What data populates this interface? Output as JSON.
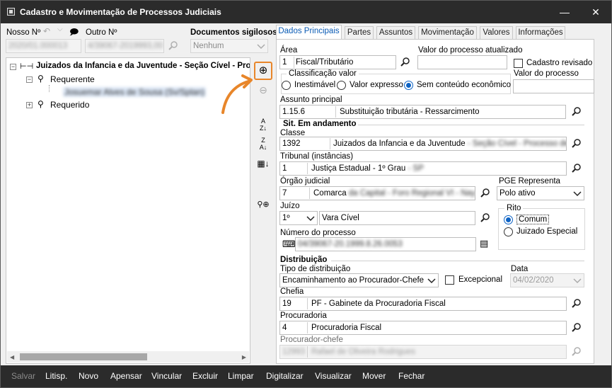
{
  "window": {
    "title": "Cadastro e Movimentação de Processos Judiciais",
    "minimize": "—",
    "maximize": "☐",
    "close": "✕"
  },
  "top": {
    "nosso_label": "Nosso Nº",
    "nosso_value": "2020/01.000013",
    "outro_label": "Outro Nº",
    "outro_value": "4/39067-2019993,00",
    "docs_label": "Documentos sigilosos",
    "docs_value": "Nenhum"
  },
  "tree": {
    "root": "Juizados da Infancia e da Juventude - Seção Cível - Proces",
    "requerente": "Requerente",
    "requerente_child": "Josuemar Alves de Sousa (Sv/Splan)",
    "requerido": "Requerido"
  },
  "tabs": [
    "Dados Principais",
    "Partes",
    "Assuntos",
    "Movimentação",
    "Valores",
    "Informações"
  ],
  "form": {
    "area_label": "Área",
    "area_code": "1",
    "area_name": "Fiscal/Tributário",
    "valor_atualizado_label": "Valor do processo atualizado",
    "cadastro_revisado": "Cadastro revisado",
    "classificacao_label": "Classificação valor",
    "opt_inestimavel": "Inestimável",
    "opt_expresso": "Valor expresso",
    "opt_sem_conteudo": "Sem conteúdo econômico",
    "valor_processo_label": "Valor do processo",
    "assunto_label": "Assunto principal",
    "assunto_code": "1.15.6",
    "assunto_name": "Substituição tributária - Ressarcimento",
    "sit_label": "Sit. Em andamento",
    "classe_label": "Classe",
    "classe_code": "1392",
    "classe_name": "Juizados da Infancia e da Juventude",
    "classe_blur": "- Seção Cível - Processo de Co",
    "tribunal_label": "Tribunal (instâncias)",
    "tribunal_code": "1",
    "tribunal_name": "Justiça Estadual - 1º Grau",
    "tribunal_blur": "- SP",
    "orgao_label": "Órgão judicial",
    "orgao_code": "7",
    "orgao_name": "Comarca",
    "orgao_blur": "da Capital - Foro Regional VI - Nay",
    "pge_label": "PGE Representa",
    "pge_value": "Polo ativo",
    "juizo_label": "Juízo",
    "juizo_code": "1º",
    "juizo_name": "Vara Cível",
    "rito_label": "Rito",
    "rito_comum": "Comum",
    "rito_juizado": "Juizado Especial",
    "numero_label": "Número do processo",
    "numero_value": "04/39067-20.1999.8.26.0053",
    "distribuicao_label": "Distribuição",
    "tipo_label": "Tipo de distribuição",
    "tipo_value": "Encaminhamento ao Procurador-Chefe",
    "excepcional": "Excepcional",
    "data_label": "Data",
    "data_value": "04/02/2020",
    "chefia_label": "Chefia",
    "chefia_code": "19",
    "chefia_name": "PF - Gabinete da Procuradoria Fiscal",
    "procuradoria_label": "Procuradoria",
    "procuradoria_code": "4",
    "procuradoria_name": "Procuradoria Fiscal",
    "procurador_label": "Procurador-chefe",
    "procurador_code": "12993",
    "procurador_name": "Rafael de Oliveira Rodrigues"
  },
  "buttons": [
    "Salvar",
    "Litisp.",
    "Novo",
    "Apensar",
    "Vincular",
    "Excluir",
    "Limpar",
    "Digitalizar",
    "Visualizar",
    "Mover",
    "Fechar"
  ],
  "colors": {
    "accent": "#0c62c4",
    "highlight": "#e8862a",
    "titlebar": "#2b2b2b"
  }
}
